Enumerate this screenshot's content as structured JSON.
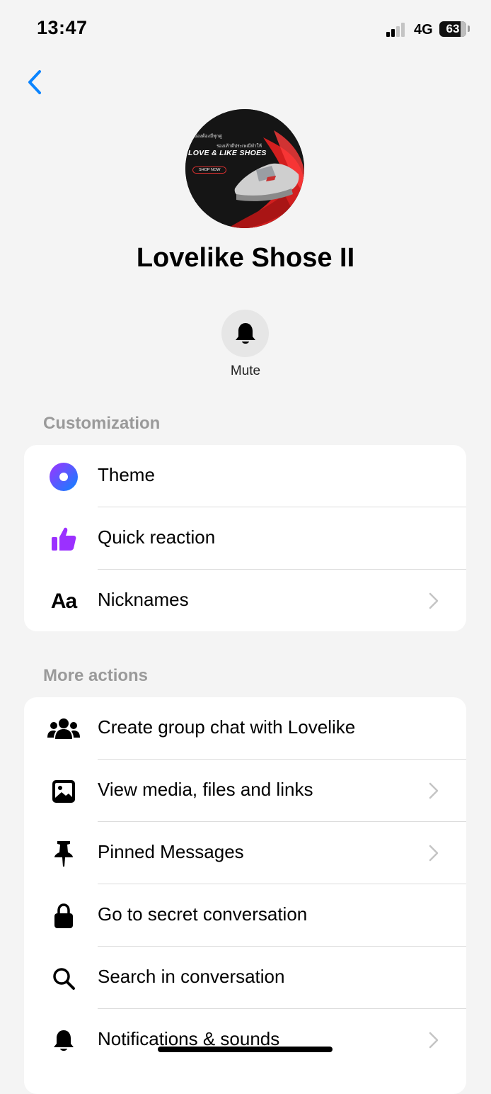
{
  "status_bar": {
    "time": "13:47",
    "network": "4G",
    "battery": "63"
  },
  "profile": {
    "avatar": {
      "kicker": "ของต้องมีทุกคู่",
      "sub": "รองเท้าดีประเพณีทำให้",
      "brand": "LOVE & LIKE SHOES",
      "shop_now": "SHOP NOW"
    },
    "name": "Lovelike Shose II"
  },
  "mute": {
    "label": "Mute"
  },
  "customization": {
    "title": "Customization",
    "items": [
      {
        "label": "Theme",
        "icon": "theme-icon",
        "chevron": false
      },
      {
        "label": "Quick reaction",
        "icon": "thumbs-up-icon",
        "chevron": false
      },
      {
        "label": "Nicknames",
        "icon_text": "Aa",
        "icon": "nicknames-icon",
        "chevron": true
      }
    ]
  },
  "more_actions": {
    "title": "More actions",
    "items": [
      {
        "label": "Create group chat with Lovelike",
        "icon": "people-icon",
        "chevron": false
      },
      {
        "label": "View media, files and links",
        "icon": "image-icon",
        "chevron": true
      },
      {
        "label": "Pinned Messages",
        "icon": "pin-icon",
        "chevron": true
      },
      {
        "label": "Go to secret conversation",
        "icon": "lock-icon",
        "chevron": false
      },
      {
        "label": "Search in conversation",
        "icon": "search-icon",
        "chevron": false
      },
      {
        "label": "Notifications & sounds",
        "icon": "bell-icon",
        "chevron": true
      }
    ]
  },
  "colors": {
    "accent": "#0a84ff",
    "theme_gradient": [
      "#a033ff",
      "#0a84ff"
    ],
    "reaction": "#9b30ff"
  }
}
